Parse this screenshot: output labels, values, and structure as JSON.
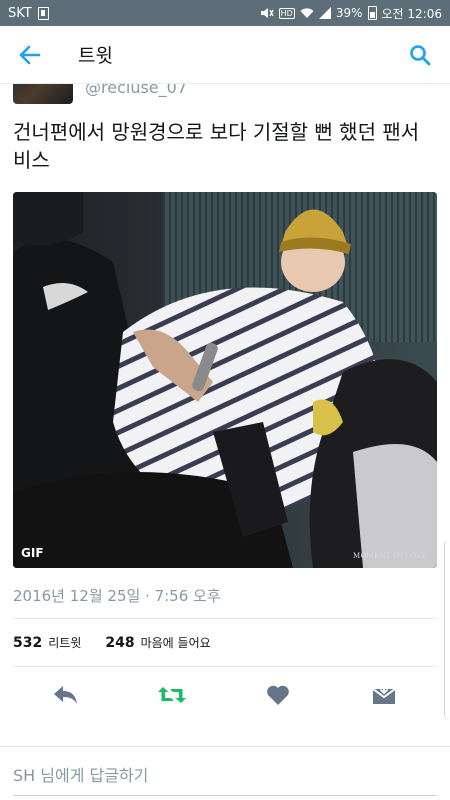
{
  "status_bar": {
    "carrier": "SKT",
    "hd_label": "HD",
    "battery": "39%",
    "time": "오전 12:06"
  },
  "header": {
    "title": "트윗"
  },
  "author": {
    "handle": "@recluse_07"
  },
  "tweet": {
    "text": "건너편에서 망원경으로 보다 기절할 뻔 했던 팬서비스",
    "media_badge": "GIF",
    "watermark": "MOMENT IN LOVE",
    "timestamp": "2016년 12월 25일 · 7:56 오후"
  },
  "stats": {
    "retweet_count": "532",
    "retweet_label": "리트윗",
    "like_count": "248",
    "like_label": "마음에 들어요"
  },
  "actions": {
    "reply_icon": "reply-icon",
    "retweet_icon": "retweet-icon",
    "like_icon": "heart-icon",
    "dm_icon": "message-icon"
  },
  "reply_bar": {
    "placeholder": "SH 님에게 답글하기"
  },
  "colors": {
    "accent": "#1da1f2",
    "retweet_green": "#17bf63",
    "icon_gray": "#657786",
    "status_bar": "#5d6e78"
  }
}
